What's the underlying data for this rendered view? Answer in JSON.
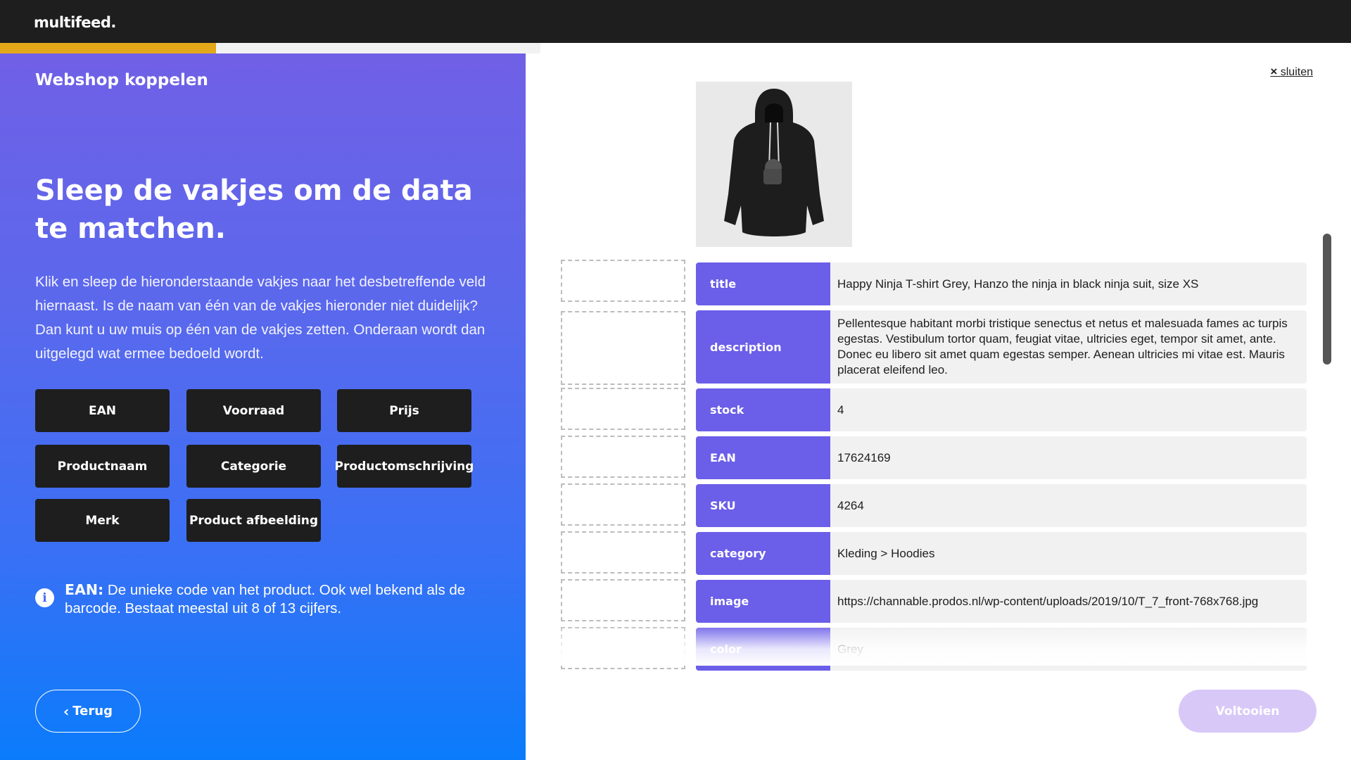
{
  "app": {
    "logo": "multifeed."
  },
  "progress": {
    "fraction": 0.4
  },
  "left": {
    "step_title": "Webshop koppelen",
    "heading": "Sleep de vakjes om de data te matchen.",
    "intro": "Klik en sleep de hieronderstaande vakjes naar het desbetreffende veld hiernaast. Is de naam van één van de vakjes hieronder niet duidelijk? Dan kunt u uw muis op één van de vakjes zetten. Onderaan wordt dan uitgelegd wat ermee bedoeld wordt.",
    "chips": [
      "EAN",
      "Voorraad",
      "Prijs",
      "Productnaam",
      "Categorie",
      "Productomschrijving",
      "Merk",
      "Product afbeelding"
    ],
    "info": {
      "term": "EAN:",
      "text": " De unieke code van het product. Ook wel bekend als de barcode. Bestaat meestal uit 8 of 13 cijfers."
    },
    "back_label": "Terug"
  },
  "right": {
    "close_icon": "×",
    "close_label": "sluiten",
    "fields": [
      {
        "key": "title",
        "value": "Happy Ninja T-shirt Grey, Hanzo the ninja in black ninja suit, size XS"
      },
      {
        "key": "description",
        "value": "Pellentesque habitant morbi tristique senectus et netus et malesuada fames ac turpis egestas. Vestibulum tortor quam, feugiat vitae, ultricies eget, tempor sit amet, ante. Donec eu libero sit amet quam egestas semper. Aenean ultricies mi vitae est. Mauris placerat eleifend leo."
      },
      {
        "key": "stock",
        "value": "4"
      },
      {
        "key": "EAN",
        "value": "17624169"
      },
      {
        "key": "SKU",
        "value": "4264"
      },
      {
        "key": "category",
        "value": "Kleding > Hoodies"
      },
      {
        "key": "image",
        "value": "https://channable.prodos.nl/wp-content/uploads/2019/10/T_7_front-768x768.jpg"
      },
      {
        "key": "color",
        "value": "Grey"
      }
    ],
    "finish_label": "Voltooien"
  },
  "colors": {
    "accent": "#6b5ee8",
    "progress": "#e2a81a",
    "topbar": "#1e1e1e"
  }
}
